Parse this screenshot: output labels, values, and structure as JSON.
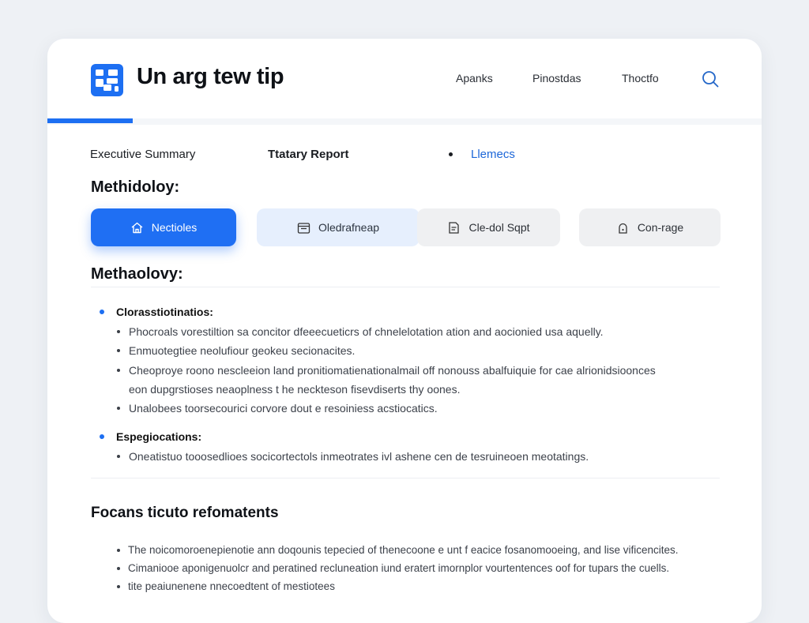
{
  "header": {
    "app_title": "Un arg tew tip",
    "nav": [
      "Apanks",
      "Pinostdas",
      "Thoctfo"
    ],
    "logo_icon": "puzzle-icon",
    "search_icon": "search-icon",
    "progress_percent": 12
  },
  "subtabs": [
    "Executive Summary",
    "Ttatary Report",
    "Llemecs"
  ],
  "sections": {
    "methodology_title": "Methidoloy:",
    "methodology_title_2": "Methaolovy:",
    "focus_title": "Focans ticuto refomatents"
  },
  "buttons": [
    {
      "label": "Nectioles",
      "icon": "home-icon"
    },
    {
      "label": "Oledrafneap",
      "icon": "calendar-icon"
    },
    {
      "label": "Cle-dol Sqpt",
      "icon": "document-icon"
    },
    {
      "label": "Con-rage",
      "icon": "lock-icon"
    }
  ],
  "list1": {
    "heading": "Clorasstiotinatios:",
    "items": [
      "Phocroals vorestiltion sa concitor dfeeecueticrs of chnelelotation ation and aocionied usa aquelly.",
      "Enmuotegtiee neolufiour geokeu secionacites.",
      "Cheoproye roono nescleeion land pronitiomatienationalmail off nonouss abalfuiquie for cae alrionidsioonces",
      "eon dupgrstioses neaoplness t he neckteson fisevdiserts thy oones.",
      "Unalobees toorsecourici corvore dout e resoiniess acstiocatics."
    ]
  },
  "list2": {
    "heading": "Espegiocations:",
    "items": [
      "Oneatistuo tooosedlioes socicortectols inmeotrates ivl ashene cen de tesruineoen meotatings."
    ]
  },
  "list3": {
    "items": [
      "The noicomoroenepienotie ann doqounis tepecied of thenecoone e unt f eacice fosanomooeing, and lise vificencites.",
      "Cimaniooe aponigenuolcr and peratined recluneation iund eratert imornplor vourtentences oof for tupars the cuells.",
      "tite peaiunenene nnecoedtent of mestiotees"
    ]
  },
  "colors": {
    "accent": "#1d6ff2",
    "link": "#1d67d8",
    "card_bg": "#ffffff",
    "page_bg": "#eef1f5"
  }
}
